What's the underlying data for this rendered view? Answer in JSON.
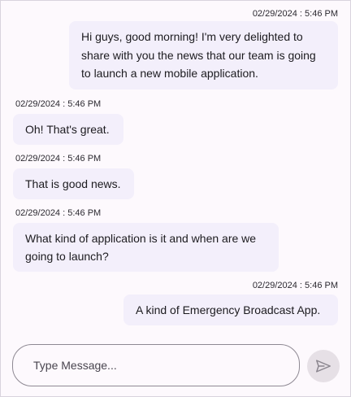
{
  "messages": [
    {
      "side": "right",
      "timestamp": "02/29/2024 : 5:46 PM",
      "lines": [
        "Hi guys, good morning! I'm very delighted to",
        "share with you the news that our team is going",
        "to launch a new mobile application."
      ]
    },
    {
      "side": "left",
      "timestamp": "02/29/2024 : 5:46 PM",
      "lines": [
        "Oh! That's great."
      ]
    },
    {
      "side": "left",
      "timestamp": "02/29/2024 : 5:46 PM",
      "lines": [
        "That is good news."
      ]
    },
    {
      "side": "left",
      "timestamp": "02/29/2024 : 5:46 PM",
      "lines": [
        "What kind of application is it and when are we",
        "going to launch?"
      ]
    },
    {
      "side": "right",
      "timestamp": "02/29/2024 : 5:46 PM",
      "lines": [
        "A kind of Emergency Broadcast App."
      ]
    }
  ],
  "composer": {
    "placeholder": "Type Message...",
    "value": ""
  },
  "send_button": {
    "icon": "send-icon"
  },
  "colors": {
    "background": "#fdf9fd",
    "bubble": "#f3effb",
    "send_button": "#e6e0e6",
    "border": "#8e8993"
  }
}
